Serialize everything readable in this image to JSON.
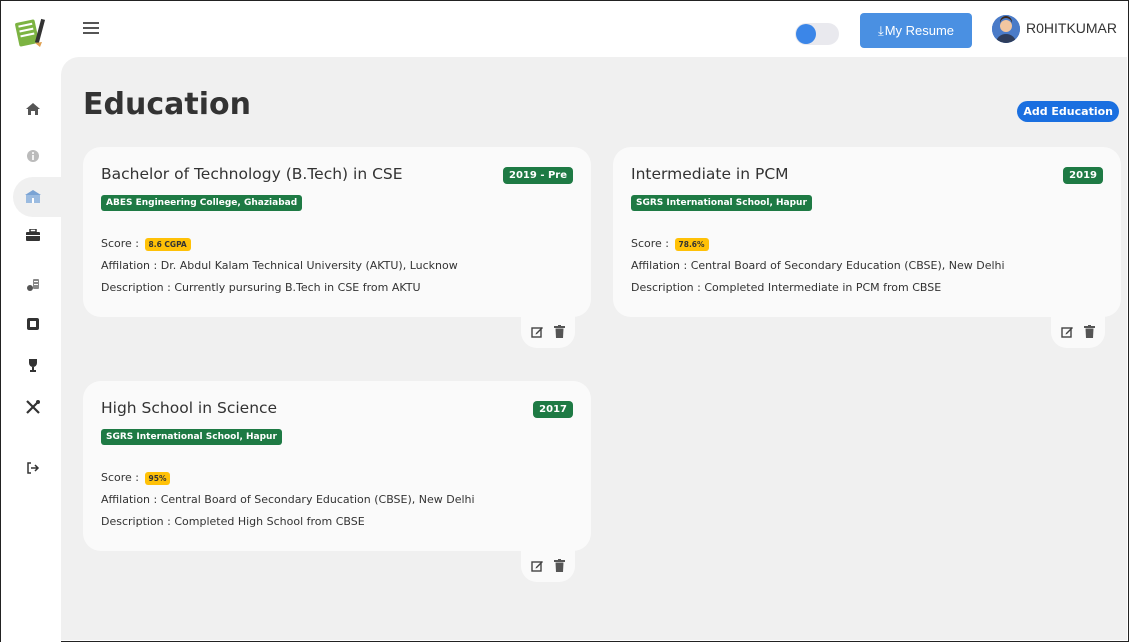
{
  "topbar": {
    "resume_label": "My Resume",
    "username": "R0HITKUMAR"
  },
  "sidebar": {
    "items": [
      {
        "name": "home-icon"
      },
      {
        "name": "info-icon"
      },
      {
        "name": "education-icon",
        "active": true
      },
      {
        "name": "briefcase-icon"
      },
      {
        "name": "skills-icon"
      },
      {
        "name": "chip-icon"
      },
      {
        "name": "trophy-icon"
      },
      {
        "name": "tools-icon"
      },
      {
        "name": "logout-icon"
      }
    ]
  },
  "page": {
    "title": "Education",
    "add_label": "Add Education"
  },
  "labels": {
    "score": "Score :",
    "affiliation": "Affilation :",
    "description": "Description :"
  },
  "cards": [
    {
      "title": "Bachelor of Technology (B.Tech) in CSE",
      "year": "2019 - Pre",
      "school": "ABES Engineering College, Ghaziabad",
      "score": "8.6 CGPA",
      "affiliation": "Dr. Abdul Kalam Technical University (AKTU), Lucknow",
      "description": "Currently pursuring B.Tech in CSE from AKTU"
    },
    {
      "title": "Intermediate in PCM",
      "year": "2019",
      "school": "SGRS International School, Hapur",
      "score": "78.6%",
      "affiliation": "Central Board of Secondary Education (CBSE), New Delhi",
      "description": "Completed Intermediate in PCM from CBSE"
    },
    {
      "title": "High School in Science",
      "year": "2017",
      "school": "SGRS International School, Hapur",
      "score": "95%",
      "affiliation": "Central Board of Secondary Education (CBSE), New Delhi",
      "description": "Completed High School from CBSE"
    }
  ],
  "colors": {
    "accent": "#4a90e2",
    "badge_green": "#1e7a44",
    "score_yellow": "#ffc107",
    "add_button": "#1a6fe0"
  }
}
